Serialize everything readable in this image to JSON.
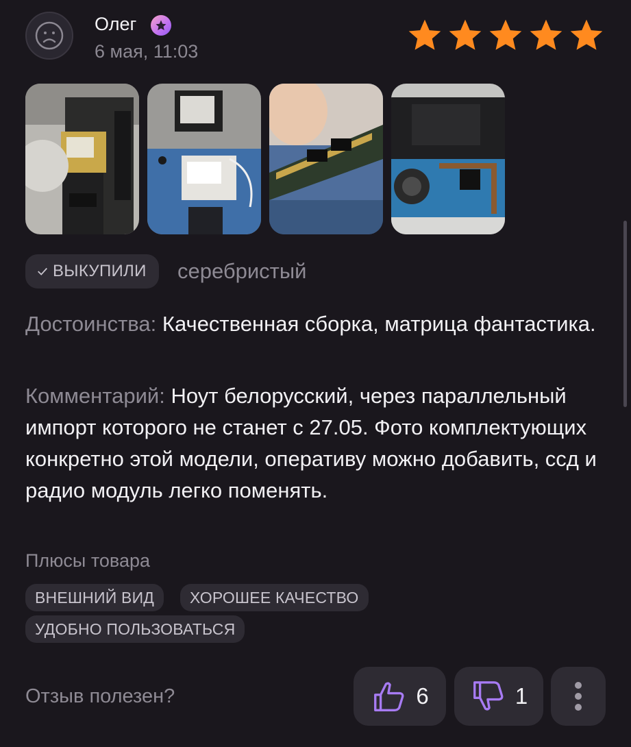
{
  "review": {
    "author": "Олег",
    "date": "6 мая, 11:03",
    "rating": 5,
    "photos": [
      "photo-ssd",
      "photo-wifi-module",
      "photo-ram",
      "photo-motherboard"
    ],
    "bought_badge": "ВЫКУПИЛИ",
    "variant": "серебристый",
    "pros_label": "Достоинства:",
    "pros_text": "Качественная сборка, матрица фантастика.",
    "comment_label": "Комментарий:",
    "comment_text": "Ноут белорусский, через параллельный импорт которого не станет с 27.05. Фото комплектующих конкретно этой модели, оперативу можно добавить, ссд и радио модуль легко поменять.",
    "product_pros_title": "Плюсы товара",
    "tags": [
      "ВНЕШНИЙ ВИД",
      "ХОРОШЕЕ КАЧЕСТВО",
      "УДОБНО ПОЛЬЗОВАТЬСЯ"
    ]
  },
  "feedback": {
    "question": "Отзыв полезен?",
    "likes": "6",
    "dislikes": "1"
  },
  "colors": {
    "background": "#1a171d",
    "star": "#ff8a1f",
    "chip": "#2e2b33",
    "accent_purple": "#a77bf3"
  },
  "icons": [
    "avatar-icon",
    "badge-star-icon",
    "star-icon",
    "check-icon",
    "thumb-up-icon",
    "thumb-down-icon",
    "more-vertical-icon"
  ]
}
